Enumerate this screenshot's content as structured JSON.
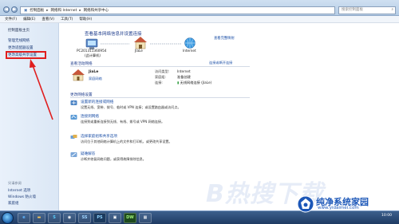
{
  "address_bar": {
    "crumbs": [
      "控制面板",
      "网络和 Internet",
      "网络和共享中心"
    ],
    "search_placeholder": "搜索控制面板"
  },
  "menu": [
    "文件(F)",
    "编辑(E)",
    "查看(V)",
    "工具(T)",
    "帮助(H)"
  ],
  "sidebar": {
    "home": "控制面板主页",
    "items": [
      "管理无线网络",
      "更改适配器设置",
      "更改高级共享设置"
    ],
    "see_also_heading": "另请参阅",
    "see_also": [
      "Internet 选项",
      "Windows 防火墙",
      "家庭组"
    ]
  },
  "main": {
    "title": "查看基本网络信息并设置连接",
    "view_full_map": "查看完整映射",
    "nodes": [
      {
        "label": "PC201311360954",
        "sub": "(此计算机)"
      },
      {
        "label": "JIaLe",
        "sub": ""
      },
      {
        "label": "Internet",
        "sub": ""
      }
    ],
    "active_heading": "查看活动网络",
    "connect_link": "连接或断开连接",
    "network": {
      "name": "JiaLe",
      "type": "家庭网络"
    },
    "props": [
      {
        "label": "访问类型:",
        "value": "Internet"
      },
      {
        "label": "家庭组:",
        "value": "准备创建"
      },
      {
        "label": "连接:",
        "value": "无线网络连接 (JiaLe)"
      }
    ],
    "change_heading": "更改网络设置",
    "tasks": [
      {
        "title": "设置新的连接或网络",
        "desc": "设置无线、宽带、拨号、临时或 VPN 连接；或设置路由器或访问点。"
      },
      {
        "title": "连接到网络",
        "desc": "连接到或重新连接到无线、有线、拨号或 VPN 网络连接。"
      },
      {
        "title": "选择家庭组和共享选项",
        "desc": "访问位于其他网络计算机上的文件和打印机，或更改共享设置。"
      },
      {
        "title": "疑难解答",
        "desc": "诊断并修复网络问题，或获得故障排除信息。"
      }
    ]
  },
  "taskbar": {
    "apps": [
      "e",
      "",
      "S",
      "",
      "SS",
      "PS",
      "",
      "DW",
      ""
    ],
    "time": "10:00"
  },
  "watermark": {
    "big": "B热搜下载",
    "brand": "纯净系统家园",
    "url": "www.yidaimei.com"
  },
  "colors": {
    "highlight_red": "#e01e1e",
    "link_blue": "#1a4ea6",
    "title_blue": "#1e3c8c"
  }
}
